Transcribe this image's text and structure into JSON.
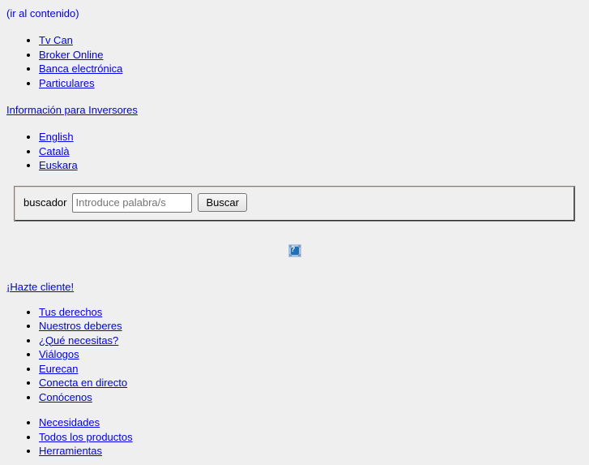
{
  "skip": {
    "label": "(ir al contenido)"
  },
  "top_nav": {
    "items": [
      {
        "label": "Tv Can"
      },
      {
        "label": "Broker Online"
      },
      {
        "label": "Banca electrónica"
      },
      {
        "label": "Particulares"
      }
    ]
  },
  "investors": {
    "label": "Información para Inversores"
  },
  "languages": {
    "items": [
      {
        "label": "English"
      },
      {
        "label": "Català"
      },
      {
        "label": "Euskara"
      }
    ]
  },
  "search": {
    "legend": "buscador",
    "placeholder": "Introduce palabra/s",
    "value": "",
    "submit_label": "Buscar"
  },
  "logo": {
    "icon": "broken-image-icon",
    "alt": "?"
  },
  "client": {
    "label": "¡Hazte cliente!"
  },
  "client_nav": {
    "items": [
      {
        "label": "Tus derechos"
      },
      {
        "label": "Nuestros deberes"
      },
      {
        "label": "¿Qué necesitas?"
      },
      {
        "label": "Viálogos"
      },
      {
        "label": "Eurecan"
      },
      {
        "label": "Conecta en directo"
      },
      {
        "label": "Conócenos"
      }
    ]
  },
  "products_nav": {
    "items": [
      {
        "label": "Necesidades"
      },
      {
        "label": "Todos los productos"
      },
      {
        "label": "Herramientas"
      }
    ]
  },
  "colors": {
    "background": "#efefef",
    "link": "#0000ee",
    "text": "#000000",
    "border": "#808080"
  }
}
